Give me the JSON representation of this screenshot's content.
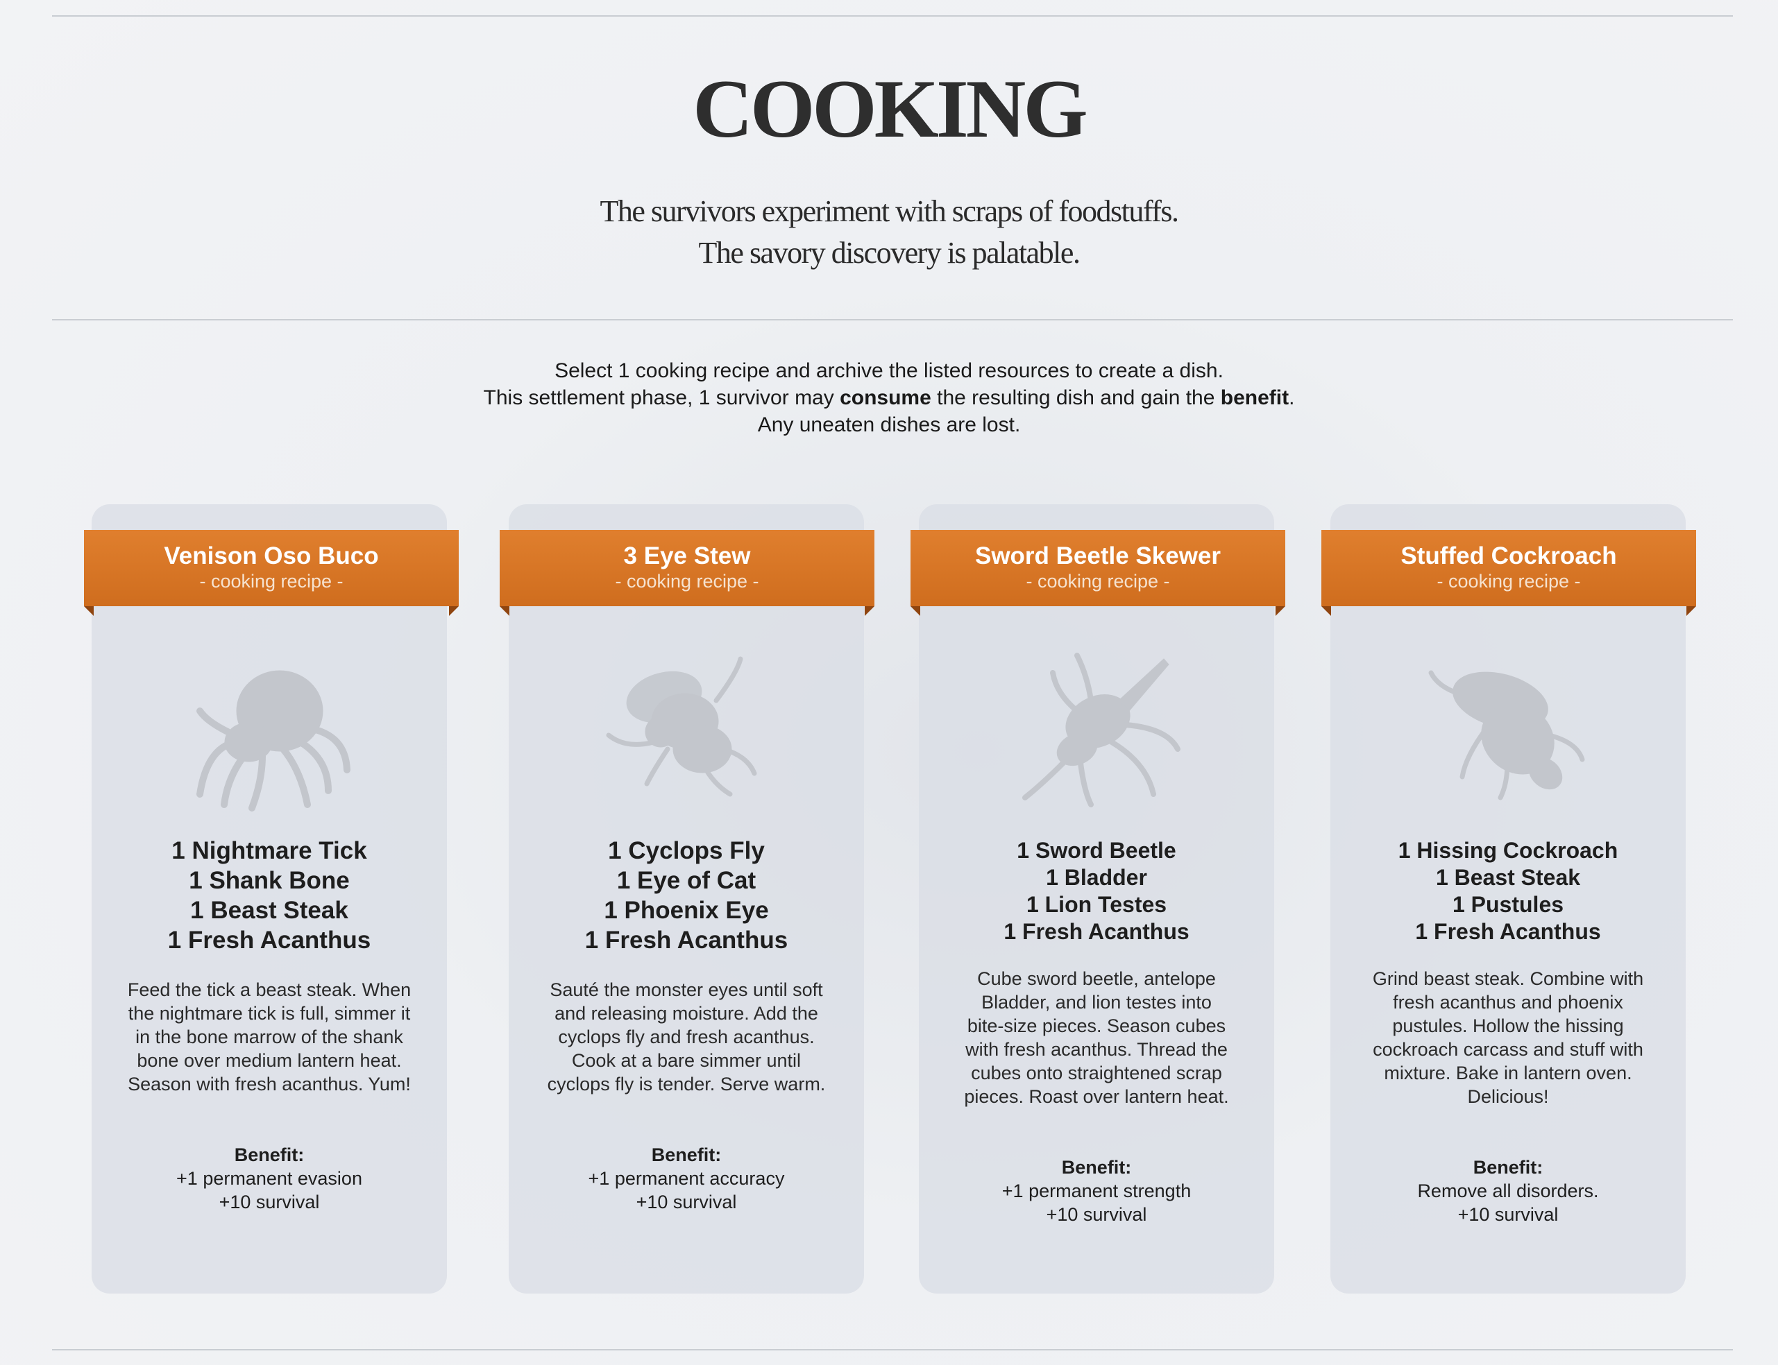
{
  "header": {
    "title": "COOKING",
    "flavor_line1": "The survivors experiment with scraps of foodstuffs.",
    "flavor_line2": "The savory discovery is palatable."
  },
  "rules": {
    "line1": "Select 1 cooking recipe and archive the listed resources to create a dish.",
    "line2_a": "This settlement phase, 1 survivor may ",
    "line2_b": "consume",
    "line2_c": " the resulting dish and gain the ",
    "line2_d": "benefit",
    "line2_e": ".",
    "line3": "Any uneaten dishes are lost."
  },
  "recipes": [
    {
      "name": "Venison Oso Buco",
      "subtitle": "- cooking recipe -",
      "creature_icon": "tick-icon",
      "ingredients": [
        "1 Nightmare Tick",
        "1 Shank Bone",
        "1 Beast Steak",
        "1 Fresh Acanthus"
      ],
      "description": [
        "Feed the tick a beast steak. When",
        "the nightmare tick is full, simmer it",
        "in the bone marrow of the shank",
        "bone over medium lantern heat.",
        "Season with fresh acanthus. Yum!"
      ],
      "benefit_label": "Benefit:",
      "benefit": [
        "+1 permanent evasion",
        "+10 survival"
      ]
    },
    {
      "name": "3 Eye Stew",
      "subtitle": "- cooking recipe -",
      "creature_icon": "fly-icon",
      "ingredients": [
        "1 Cyclops Fly",
        "1 Eye of Cat",
        "1 Phoenix Eye",
        "1 Fresh Acanthus"
      ],
      "description": [
        "Sauté the monster eyes until soft",
        "and releasing moisture. Add the",
        "cyclops fly and fresh acanthus.",
        "Cook at a bare simmer until",
        "cyclops fly is tender. Serve warm."
      ],
      "benefit_label": "Benefit:",
      "benefit": [
        "+1 permanent accuracy",
        "+10 survival"
      ]
    },
    {
      "name": "Sword Beetle Skewer",
      "subtitle": "- cooking recipe -",
      "creature_icon": "beetle-icon",
      "ingredients": [
        "1 Sword Beetle",
        "1 Bladder",
        "1 Lion Testes",
        "1 Fresh Acanthus"
      ],
      "description": [
        "Cube sword beetle, antelope",
        "Bladder, and lion testes into",
        "bite-size pieces. Season cubes",
        "with fresh acanthus. Thread the",
        "cubes onto straightened scrap",
        "pieces. Roast over lantern heat."
      ],
      "benefit_label": "Benefit:",
      "benefit": [
        "+1 permanent strength",
        "+10 survival"
      ]
    },
    {
      "name": "Stuffed Cockroach",
      "subtitle": "- cooking recipe -",
      "creature_icon": "cockroach-icon",
      "ingredients": [
        "1 Hissing Cockroach",
        "1 Beast Steak",
        "1 Pustules",
        "1 Fresh Acanthus"
      ],
      "description": [
        "Grind beast steak. Combine with",
        "fresh acanthus and phoenix",
        "pustules. Hollow the hissing",
        "cockroach carcass and stuff with",
        "mixture. Bake in lantern oven.",
        "Delicious!"
      ],
      "benefit_label": "Benefit:",
      "benefit": [
        "Remove all disorders.",
        "+10 survival"
      ]
    }
  ]
}
